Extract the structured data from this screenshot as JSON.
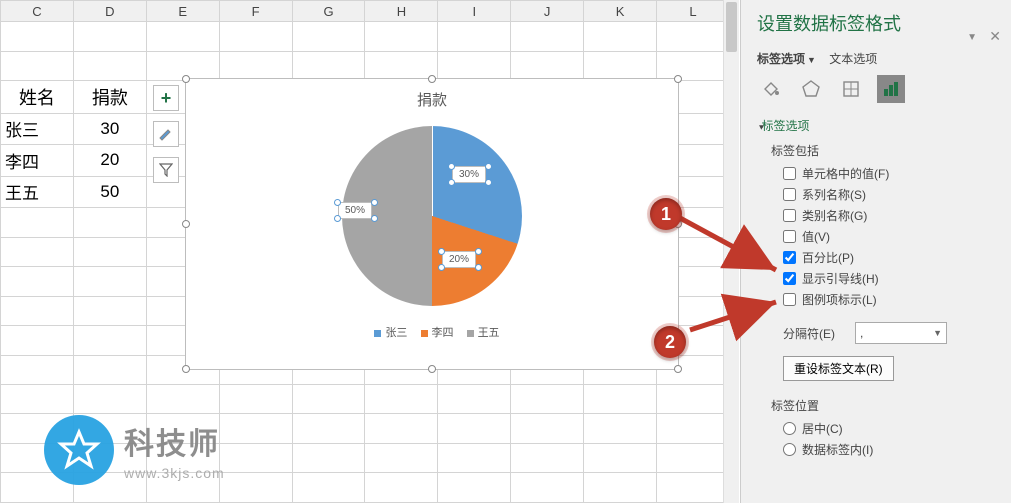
{
  "columns": [
    "C",
    "D",
    "E",
    "F",
    "G",
    "H",
    "I",
    "J",
    "K",
    "L"
  ],
  "table": {
    "headers": {
      "name": "姓名",
      "value": "捐款"
    },
    "rows": [
      {
        "name": "张三",
        "value": "30"
      },
      {
        "name": "李四",
        "value": "20"
      },
      {
        "name": "王五",
        "value": "50"
      }
    ]
  },
  "chart_data": {
    "type": "pie",
    "title": "捐款",
    "categories": [
      "张三",
      "李四",
      "王五"
    ],
    "values": [
      30,
      20,
      50
    ],
    "percentages": [
      "30%",
      "20%",
      "50%"
    ],
    "colors": [
      "#5b9bd5",
      "#ed7d31",
      "#a5a5a5"
    ],
    "legend_position": "bottom",
    "data_labels": {
      "show_percentage": true
    }
  },
  "chart": {
    "title": "捐款",
    "labels": {
      "a": "30%",
      "b": "20%",
      "c": "50%"
    },
    "legend": {
      "a": "张三",
      "b": "李四",
      "c": "王五"
    }
  },
  "panel": {
    "title": "设置数据标签格式",
    "tabs": {
      "label_options": "标签选项",
      "text_options": "文本选项"
    },
    "section": "标签选项",
    "includes_label": "标签包括",
    "opts": {
      "cell_value": "单元格中的值(F)",
      "series_name": "系列名称(S)",
      "category_name": "类别名称(G)",
      "value": "值(V)",
      "percentage": "百分比(P)",
      "leader_lines": "显示引导线(H)",
      "legend_key": "图例项标示(L)"
    },
    "separator_label": "分隔符(E)",
    "separator_value": ",",
    "reset_button": "重设标签文本(R)",
    "position_label": "标签位置",
    "positions": {
      "center": "居中(C)",
      "inside_end": "数据标签内(I)"
    }
  },
  "markers": {
    "one": "1",
    "two": "2"
  },
  "watermark": {
    "title": "科技师",
    "url": "www.3kjs.com"
  }
}
